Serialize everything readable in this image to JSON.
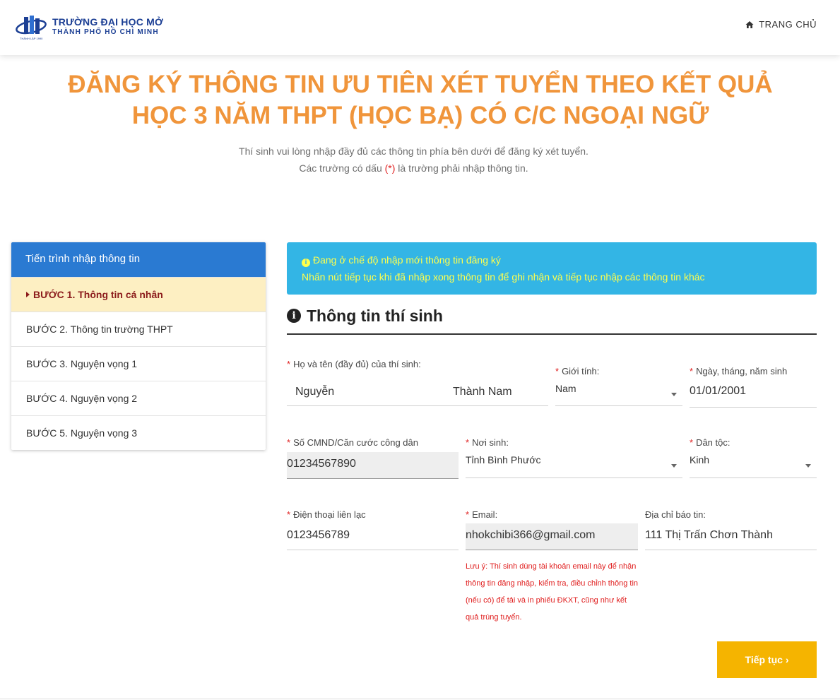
{
  "header": {
    "logo_line1": "TRƯỜNG ĐẠI HỌC MỞ",
    "logo_line2": "THÀNH PHỐ HỒ CHÍ MINH",
    "logo_small": "THÀNH LẬP 1990",
    "home_label": "TRANG CHỦ"
  },
  "title": {
    "line1": "ĐĂNG KÝ THÔNG TIN ƯU TIÊN XÉT TUYỂN THEO KẾT QUẢ",
    "line2": "HỌC 3 NĂM THPT (HỌC BẠ) CÓ C/C NGOẠI NGỮ"
  },
  "subtitle": {
    "line1": "Thí sinh vui lòng nhập đầy đủ các thông tin phía bên dưới để đăng ký xét tuyển.",
    "line2_before": "Các trường có dấu ",
    "line2_mark": "(*)",
    "line2_after": " là trường phải nhập thông tin."
  },
  "sidebar": {
    "heading": "Tiến trình nhập thông tin",
    "steps": [
      "BƯỚC 1. Thông tin cá nhân",
      "BƯỚC 2. Thông tin trường THPT",
      "BƯỚC 3. Nguyện vọng 1",
      "BƯỚC 4. Nguyện vọng 2",
      "BƯỚC 5. Nguyện vọng 3"
    ]
  },
  "alert": {
    "line1": "Đang ở chế độ nhập mới thông tin đăng ký",
    "line2": "Nhấn nút tiếp tục khi đã nhập xong thông tin để ghi nhận và tiếp tục nhập các thông tin khác"
  },
  "section_title": "Thông tin thí sinh",
  "form": {
    "fullname": {
      "label": "Họ và tên (đầy đủ) của thí sinh:",
      "last": "Nguyễn",
      "first": "Thành Nam"
    },
    "gender": {
      "label": "Giới tính:",
      "value": "Nam"
    },
    "dob": {
      "label": "Ngày, tháng, năm sinh",
      "value": "01/01/2001"
    },
    "id_number": {
      "label": "Số CMND/Căn cước công dân",
      "value": "01234567890"
    },
    "birthplace": {
      "label": "Nơi sinh:",
      "value": "Tỉnh Bình Phước"
    },
    "ethnicity": {
      "label": "Dân tộc:",
      "value": "Kinh"
    },
    "phone": {
      "label": "Điện thoại liên lạc",
      "value": "0123456789"
    },
    "email": {
      "label": "Email:",
      "value": "nhokchibi366@gmail.com"
    },
    "address": {
      "label": "Địa chỉ báo tin:",
      "value": "111 Thị Trấn Chơn Thành"
    },
    "required_mark": "*"
  },
  "email_note": "Lưu ý: Thí sinh dùng tài khoản email này để nhận thông tin đăng nhập, kiểm tra, điều chỉnh thông tin (nếu có) để tải và in phiếu ĐKXT, cũng như kết quả trúng tuyển.",
  "next_button": "Tiếp tục ›",
  "colors": {
    "title": "#f0953b",
    "primary": "#2a7ad2",
    "alert_bg": "#33b5e5",
    "alert_text": "#ffff4d",
    "button": "#f5b400",
    "required": "#e02020"
  }
}
